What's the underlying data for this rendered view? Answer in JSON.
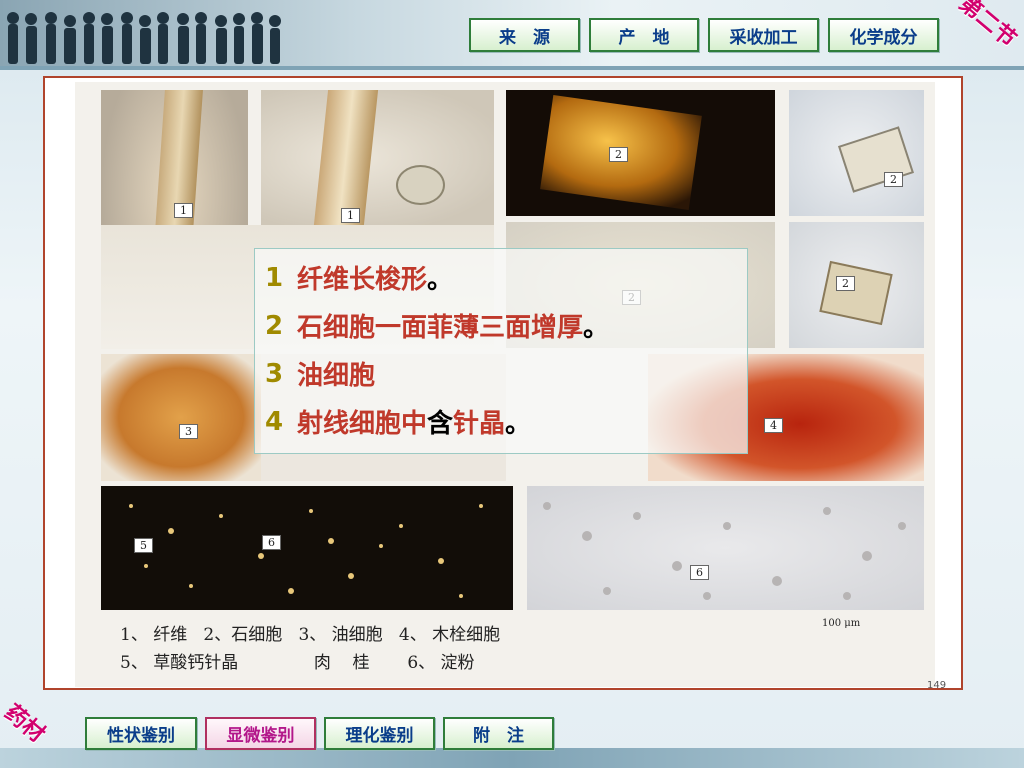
{
  "top_nav": {
    "tabs": [
      {
        "label": "来　源"
      },
      {
        "label": "产　地"
      },
      {
        "label": "采收加工"
      },
      {
        "label": "化学成分"
      }
    ],
    "corner_label": "第二节"
  },
  "bottom_nav": {
    "tabs": [
      {
        "label": "性状鉴别",
        "active": false
      },
      {
        "label": "显微鉴别",
        "active": true
      },
      {
        "label": "理化鉴别",
        "active": false
      },
      {
        "label": "附　注",
        "active": false
      }
    ],
    "corner_label": "药材"
  },
  "plate": {
    "photo_labels": [
      "1",
      "1",
      "2",
      "2",
      "2",
      "2",
      "3",
      "4",
      "5",
      "6",
      "6"
    ],
    "caption_line1": "1、 纤维   2、石细胞   3、 油细胞   4、 木栓细胞",
    "caption_line2": "5、 草酸钙针晶              肉    桂       6、 淀粉",
    "scale_label": "100 μm",
    "page_number": "149"
  },
  "overlay": {
    "items": [
      {
        "num": "1",
        "text": "纤维长梭形",
        "tail": "。"
      },
      {
        "num": "2",
        "text": "石细胞一面菲薄三面增厚",
        "tail": "。"
      },
      {
        "num": "3",
        "text": "油细胞",
        "tail": ""
      },
      {
        "num": "4",
        "text": "射线细胞中",
        "keyword": "含",
        "text2": "针晶",
        "tail": "。"
      }
    ]
  },
  "colors": {
    "accent_green": "#2f7d3a",
    "nav_text": "#0a3d8a",
    "active_tab_text": "#b3178a",
    "overlay_text": "#c0392b",
    "overlay_number": "#a08a00",
    "frame_border": "#b0442c"
  }
}
